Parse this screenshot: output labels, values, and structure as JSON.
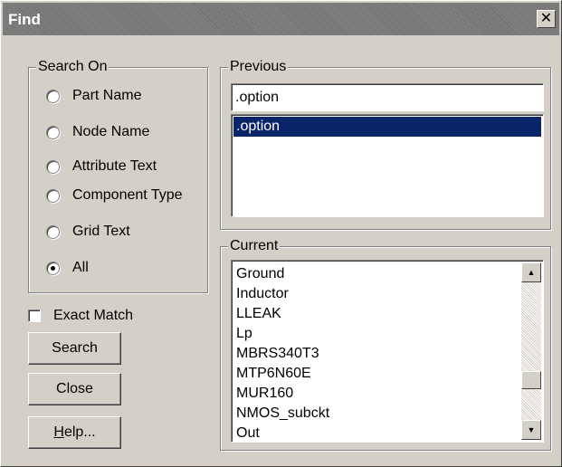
{
  "window": {
    "title": "Find",
    "close_symbol": "✕"
  },
  "search_on": {
    "legend": "Search On",
    "options": [
      {
        "label": "Part Name",
        "checked": false
      },
      {
        "label": "Node Name",
        "checked": false
      },
      {
        "label": "Attribute Text",
        "checked": false
      },
      {
        "label": "Component Type",
        "checked": false
      },
      {
        "label": "Grid Text",
        "checked": false
      },
      {
        "label": "All",
        "checked": true
      }
    ]
  },
  "exact_match": {
    "label": "Exact Match",
    "checked": false
  },
  "buttons": {
    "search": "Search",
    "close": "Close",
    "help_underlined": "H",
    "help_rest": "elp..."
  },
  "previous": {
    "legend": "Previous",
    "input_value": ".option",
    "items": [
      ".option"
    ]
  },
  "current": {
    "legend": "Current",
    "items": [
      "Ground",
      "Inductor",
      "LLEAK",
      "Lp",
      "MBRS340T3",
      "MTP6N60E",
      "MUR160",
      "NMOS_subckt",
      "Out"
    ]
  },
  "icons": {
    "close": "close-icon",
    "scroll_up": "scroll-up-arrow-icon",
    "scroll_down": "scroll-down-arrow-icon"
  },
  "colors": {
    "selection": "#0a246a",
    "face": "#d4d0c8",
    "titlebar": "#7a7a7a"
  }
}
